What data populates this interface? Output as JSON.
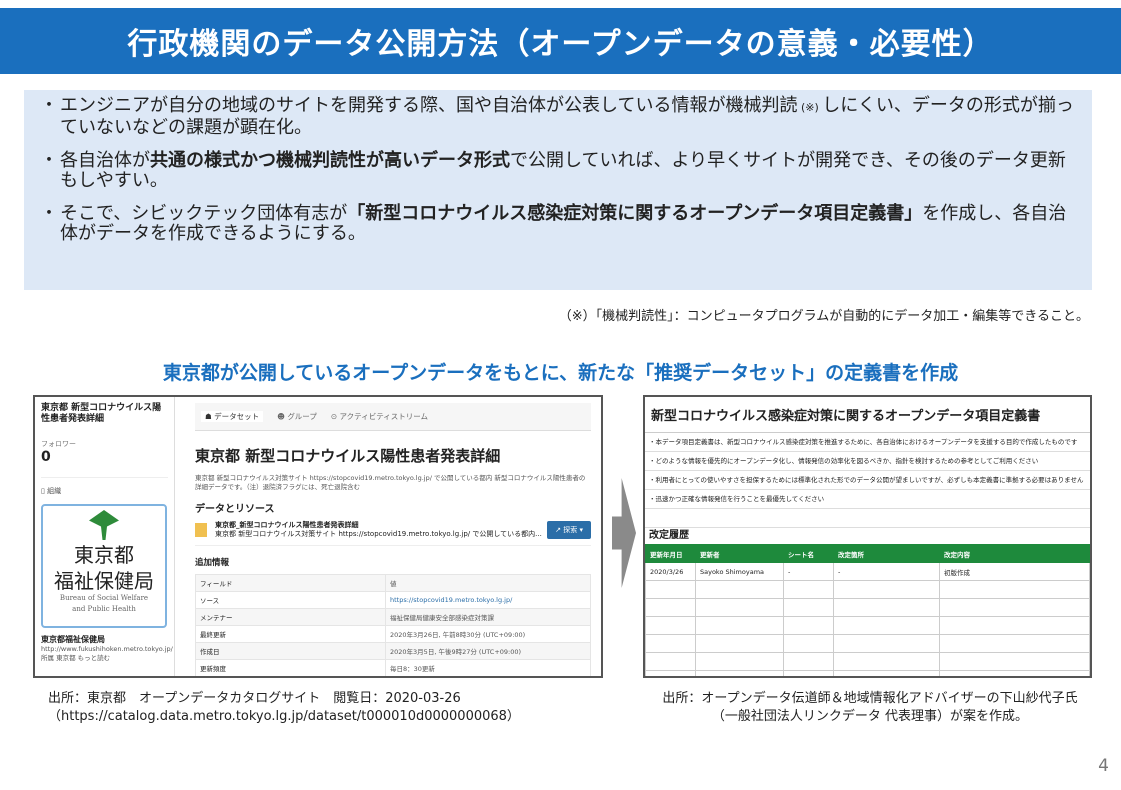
{
  "title": "行政機関のデータ公開方法（オープンデータの意義・必要性）",
  "bullets": [
    {
      "parts": [
        {
          "t": "エンジニアが自分の地域のサイトを開発する際、国や自治体が公表している情報が機械判読",
          "b": false
        },
        {
          "t": " (※) ",
          "b": false,
          "small": true
        },
        {
          "t": "しにくい、データの形式が揃っていないなどの課題が顕在化。",
          "b": false
        }
      ]
    },
    {
      "parts": [
        {
          "t": "各自治体が",
          "b": false
        },
        {
          "t": "共通の様式かつ機械判読性が高いデータ形式",
          "b": true
        },
        {
          "t": "で公開していれば、より早くサイトが開発でき、その後のデータ更新もしやすい。",
          "b": false
        }
      ]
    },
    {
      "parts": [
        {
          "t": "そこで、シビックテック団体有志が",
          "b": false
        },
        {
          "t": "「新型コロナウイルス感染症対策に関するオープンデータ項目定義書」",
          "b": true
        },
        {
          "t": "を作成し、各自治体がデータを作成できるようにする。",
          "b": false
        }
      ]
    }
  ],
  "bullet_marker": "・",
  "footnote": "（※）「機械判読性」：コンピュータプログラムが自動的にデータ加工・編集等できること。",
  "subheading": "東京都が公開しているオープンデータをもとに、新たな「推奨データセット」の定義書を作成",
  "catalog": {
    "sidebar": {
      "dataset_name": "東京都 新型コロナウイルス陽性患者発表詳細",
      "followers_label": "フォロワー",
      "followers_count": "0",
      "org_section": "組織",
      "logo_line1": "東京都",
      "logo_line2": "福祉保健局",
      "logo_en1": "Bureau of Social Welfare",
      "logo_en2": "and Public Health",
      "org_name": "東京都福祉保健局",
      "org_url": "http://www.fukushihoken.metro.tokyo.jp/",
      "org_desc": "所属 東京都 もっと読む"
    },
    "tabs": [
      "データセット",
      "グループ",
      "アクティビティストリーム"
    ],
    "heading": "東京都 新型コロナウイルス陽性患者発表詳細",
    "description": "東京都 新型コロナウイルス対策サイト https://stopcovid19.metro.tokyo.lg.jp/ で公開している都内 新型コロナウイルス陽性患者の詳細データです。（注）退院済フラグには、死亡退院含む",
    "resources_heading": "データとリソース",
    "resource_title": "東京都_新型コロナウイルス陽性患者発表詳細",
    "resource_desc": "東京都 新型コロナウイルス対策サイト https://stopcovid19.metro.tokyo.lg.jp/ で公開している都内...",
    "explore_label": "↗ 探索 ▾",
    "additional_heading": "追加情報",
    "info_rows": [
      {
        "k": "フィールド",
        "v": "値"
      },
      {
        "k": "ソース",
        "v": "https://stopcovid19.metro.tokyo.lg.jp/"
      },
      {
        "k": "メンテナー",
        "v": "福祉保健局健康安全部感染症対策課"
      },
      {
        "k": "最終更新",
        "v": "2020年3月26日, 午前8時30分 (UTC+09:00)"
      },
      {
        "k": "作成日",
        "v": "2020年3月5日, 午後9時27分 (UTC+09:00)"
      },
      {
        "k": "更新頻度",
        "v": "毎日8：30更新"
      }
    ]
  },
  "definition": {
    "title": "新型コロナウイルス感染症対策に関するオープンデータ項目定義書",
    "lines": [
      "・本データ項目定義書は、新型コロナウイルス感染症対策を推進するために、各自治体におけるオープンデータを支援する目的で作成したものです",
      "・どのような情報を優先的にオープンデータ化し、情報発信の効率化を図るべきか、指針を検討するための参考としてご利用ください",
      "・利用者にとっての使いやすさを担保するためには標準化された形でのデータ公開が望ましいですが、必ずしも本定義書に準拠する必要はありません",
      "・迅速かつ正確な情報発信を行うことを最優先してください"
    ],
    "history_heading": "改定履歴",
    "history_headers": [
      "更新年月日",
      "更新者",
      "シート名",
      "改定箇所",
      "改定内容"
    ],
    "history_rows": [
      [
        "2020/3/26",
        "Sayoko Shimoyama",
        "-",
        "-",
        "初版作成"
      ]
    ]
  },
  "caption_left": [
    "出所：東京都　オープンデータカタログサイト　閲覧日：2020-03-26",
    "（https://catalog.data.metro.tokyo.lg.jp/dataset/t000010d0000000068）"
  ],
  "caption_right": [
    "出所：オープンデータ伝道師＆地域情報化アドバイザーの下山紗代子氏",
    "（一般社団法人リンクデータ 代表理事）が案を作成。"
  ],
  "page_number": "4"
}
